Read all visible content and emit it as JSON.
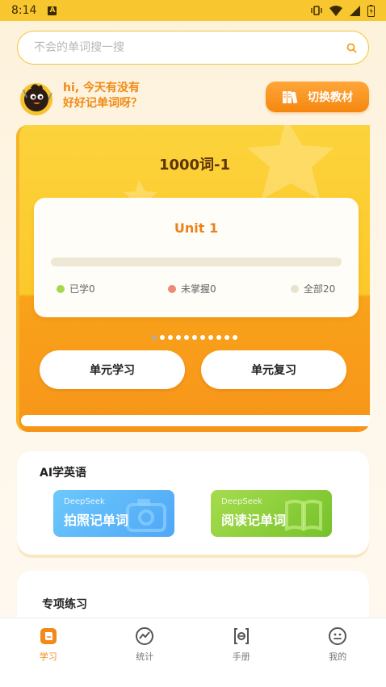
{
  "status_bar": {
    "time": "8:14",
    "notification_icon": "A"
  },
  "search": {
    "placeholder": "不会的单词搜一搜"
  },
  "greeting": {
    "line1": "hi, 今天有没有",
    "line2": "好好记单词呀？"
  },
  "switch_textbook": {
    "label": "切换教材",
    "icon": "books-icon"
  },
  "study_card": {
    "book_title": "1000词-1",
    "unit_title": "Unit 1",
    "progress": 0,
    "legend": [
      {
        "label": "已学0",
        "color": "#a8d64f"
      },
      {
        "label": "未掌握0",
        "color": "#f08a78"
      },
      {
        "label": "全部20",
        "color": "#e8e3cf"
      }
    ],
    "pager_total": 11,
    "pager_active": 0,
    "learn_button": "单元学习",
    "review_button": "单元复习"
  },
  "ai_section": {
    "title": "AI学英语",
    "buttons": [
      {
        "sub": "DeepSeek",
        "label": "拍照记单词",
        "icon": "camera-icon"
      },
      {
        "sub": "DeepSeek",
        "label": "阅读记单词",
        "icon": "book-icon"
      }
    ]
  },
  "special_practice": {
    "title": "专项练习"
  },
  "nav": {
    "items": [
      {
        "label": "学习",
        "icon": "study-icon",
        "active": true
      },
      {
        "label": "统计",
        "icon": "stats-icon",
        "active": false
      },
      {
        "label": "手册",
        "icon": "handbook-icon",
        "active": false
      },
      {
        "label": "我的",
        "icon": "profile-icon",
        "active": false
      }
    ]
  },
  "colors": {
    "accent_orange": "#f5870f",
    "card_yellow": "#fcd33c",
    "status_bar": "#f8c62f"
  }
}
